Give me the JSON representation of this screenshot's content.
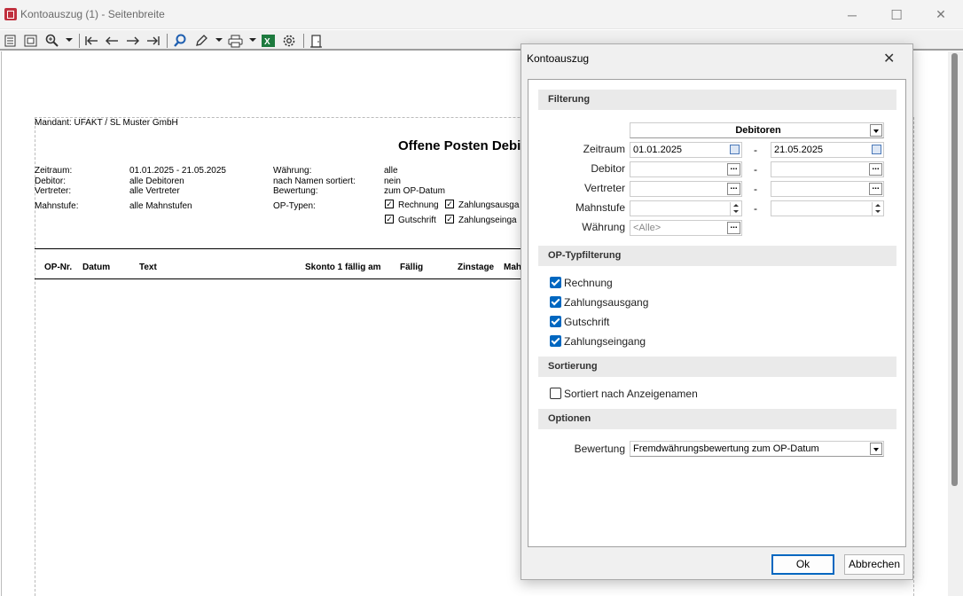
{
  "window": {
    "title": "Kontoauszug (1) - Seitenbreite",
    "minimize": "─",
    "maximize": "☐",
    "close": "✕"
  },
  "report": {
    "mandant": "Mandant: UFAKT / SL Muster GmbH",
    "title": "Offene Posten Debit",
    "rows": [
      {
        "l1": "Zeitraum:",
        "v1": "01.01.2025 - 21.05.2025",
        "l2": "Währung:",
        "v2": "alle"
      },
      {
        "l1": "Debitor:",
        "v1": "alle Debitoren",
        "l2": "nach Namen sortiert:",
        "v2": "nein"
      },
      {
        "l1": "Vertreter:",
        "v1": "alle Vertreter",
        "l2": "Bewertung:",
        "v2": "zum OP-Datum"
      },
      {
        "l1": "Mahnstufe:",
        "v1": "alle Mahnstufen",
        "l2": "OP-Typen:",
        "v2": ""
      }
    ],
    "op_types": [
      "Rechnung",
      "Zahlungsausga",
      "Gutschrift",
      "Zahlungseinga"
    ],
    "columns": [
      "OP-Nr.",
      "Datum",
      "Text",
      "Skonto 1 fällig am",
      "Fällig",
      "Zinstage",
      "Mah"
    ]
  },
  "dialog": {
    "title": "Kontoauszug",
    "close": "✕",
    "sections": {
      "filtering": "Filterung",
      "op_type_filtering": "OP-Typfilterung",
      "sorting": "Sortierung",
      "options": "Optionen"
    },
    "account_type": "Debitoren",
    "labels": {
      "period": "Zeitraum",
      "debtor": "Debitor",
      "rep": "Vertreter",
      "dunning": "Mahnstufe",
      "currency": "Währung",
      "valuation": "Bewertung"
    },
    "period_from": "01.01.2025",
    "period_to": "21.05.2025",
    "range_dash": "-",
    "ellipsis": "...",
    "currency_placeholder": "<Alle>",
    "op_types": [
      {
        "label": "Rechnung",
        "checked": true
      },
      {
        "label": "Zahlungsausgang",
        "checked": true
      },
      {
        "label": "Gutschrift",
        "checked": true
      },
      {
        "label": "Zahlungseingang",
        "checked": true
      }
    ],
    "sort_by_display_name": {
      "label": "Sortiert nach Anzeigenamen",
      "checked": false
    },
    "valuation_value": "Fremdwährungsbewertung zum OP-Datum",
    "ok": "Ok",
    "cancel": "Abbrechen"
  },
  "colors": {
    "accent": "#0067c0",
    "app_icon": "#c0303e",
    "excel": "#1d7a3e"
  }
}
